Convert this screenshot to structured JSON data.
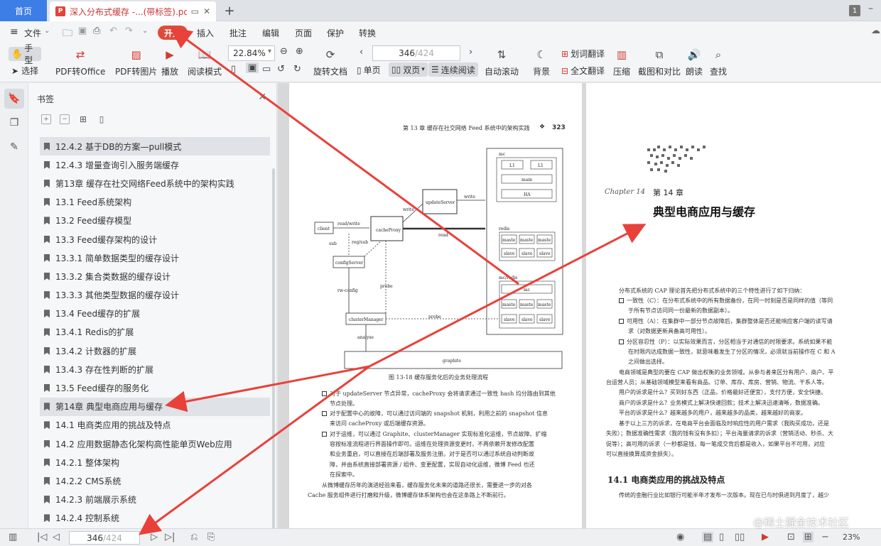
{
  "tabs": {
    "home_label": "首页",
    "doc_title": "深入分布式缓存 -...(带标签).pdf",
    "window_count": "1"
  },
  "menubar": {
    "file_label": "文件",
    "kaishi_label": "开始",
    "items": [
      "插入",
      "批注",
      "编辑",
      "页面",
      "保护",
      "转换"
    ]
  },
  "toolbar": {
    "hand_label": "手型",
    "select_label": "选择",
    "pdf_to_office": "PDF转Office",
    "pdf_to_image": "PDF转图片",
    "play": "播放",
    "read_mode": "阅读模式",
    "zoom_value": "22.84%",
    "rotate_doc": "旋转文档",
    "single_page": "单页",
    "double_page": "双页",
    "continuous_read": "连续阅读",
    "page_current": "346",
    "page_total": "/424",
    "auto_scroll": "自动滚动",
    "background": "背景",
    "word_translate": "划词翻译",
    "full_translate": "全文翻译",
    "compress": "压缩",
    "screenshot_compare": "截图和对比",
    "read_aloud": "朗读",
    "find": "查找"
  },
  "bookmarks": {
    "title": "书签",
    "items": [
      {
        "label": "12.4.2   基于DB的方案—pull模式",
        "highlighted": true
      },
      {
        "label": "12.4.3   增量查询引入服务端缓存",
        "highlighted": false
      },
      {
        "label": "第13章    缓存在社交网络Feed系统中的架构实践",
        "highlighted": false
      },
      {
        "label": "13.1   Feed系统架构",
        "highlighted": false
      },
      {
        "label": "13.2   Feed缓存模型",
        "highlighted": false
      },
      {
        "label": "13.3   Feed缓存架构的设计",
        "highlighted": false
      },
      {
        "label": "13.3.1   简单数据类型的缓存设计",
        "highlighted": false
      },
      {
        "label": "13.3.2   集合类数据的缓存设计",
        "highlighted": false
      },
      {
        "label": "13.3.3   其他类型数据的缓存设计",
        "highlighted": false
      },
      {
        "label": "13.4   Feed缓存的扩展",
        "highlighted": false
      },
      {
        "label": "13.4.1   Redis的扩展",
        "highlighted": false
      },
      {
        "label": "13.4.2   计数器的扩展",
        "highlighted": false
      },
      {
        "label": "13.4.3   存在性判断的扩展",
        "highlighted": false
      },
      {
        "label": "13.5   Feed缓存的服务化",
        "highlighted": false
      },
      {
        "label": "第14章    典型电商应用与缓存",
        "highlighted": true
      },
      {
        "label": "14.1   电商类应用的挑战及特点",
        "highlighted": false
      },
      {
        "label": "14.2   应用数据静态化架构高性能单页Web应用",
        "highlighted": false
      },
      {
        "label": "14.2.1   整体架构",
        "highlighted": false
      },
      {
        "label": "14.2.2   CMS系统",
        "highlighted": false
      },
      {
        "label": "14.2.3   前端展示系统",
        "highlighted": false
      },
      {
        "label": "14.2.4   控制系统",
        "highlighted": false
      }
    ]
  },
  "left_page": {
    "running_head": "第 13 章   缓存在社交网络 Feed 系统中的架构实践",
    "page_number": "323",
    "diagram": {
      "mc": "mc",
      "l1": "L1",
      "main": "main",
      "ha": "HA",
      "redis": "redis",
      "maste": "maste",
      "slave": "slave",
      "mcredis": "mc/redis",
      "mc_inner": "mc",
      "client": "client",
      "cacheproxy": "cacheProxy",
      "updateserver": "updateServer",
      "configserver": "configServer",
      "clustermanager": "clusterManager",
      "graphite": "graphite",
      "readwrite": "read/write",
      "write1": "write",
      "write2": "write",
      "read": "read",
      "sub": "sub",
      "regsub": "reg/sub",
      "rwconfig": "rw-config",
      "probe1": "probe",
      "probe2": "probe",
      "analyse": "analyse"
    },
    "figure_caption": "图 13-18   缓存服务化后的业务处理流程",
    "paragraphs": [
      "对于 updateServer 节点异常，cacheProxy 会将请求通过一致性 hash 均分路由到其他",
      "节点处理。",
      "对于配置中心的故障，可以通过访问端的 snapshot 机制，利用之前的 snapshot 信息",
      "来访问 cacheProxy 或后端缓存资源。",
      "对于运维，可以通过 Graphite、clusterManager 实现标准化运维，节点故障、扩缩",
      "容按标准流程进行界面操作即可。运维在处理资源变更时，不再依赖开发修改配置",
      "和业务重启，可以直接在后端部署及服务注册。对于是否可以通过系统自动判断故",
      "障，并由系统直接部署资源 / 组件、变更配置，实现自动化运维，微博 Feed 也还",
      "在探索中。",
      "从微博缓存历年的演进经验来看，缓存服务化未来的道路还很长，需要进一步的对各",
      "Cache 服务组件进行打磨和升级，微博缓存体系架构也会在这条路上不断前行。"
    ]
  },
  "right_page": {
    "chapter_script": "Chapter 14",
    "chapter_label": "第 14 章",
    "chapter_title": "典型电商应用与缓存",
    "paragraphs": [
      "分布式系统的 CAP 理论首先把分布式系统中的三个特性进行了如下归纳：",
      "一致性（C）：在分布式系统中的所有数据备份，在同一时刻是否是同样的值（等同",
      "于所有节点访问同一份最新的数据副本）。",
      "可用性（A）：在集群中一部分节点故障后，集群整体是否还能响应客户端的读写请",
      "求（对数据更新具备高可用性）。",
      "分区容忍性（P）：以实际效果而言，分区相当于对通信的时限要求。系统如果不能",
      "在时限内达成数据一致性，就意味着发生了分区的情况，必须就当前操作在 C 和 A",
      "之间做出选择。",
      "电商领域是典型的要在 CAP 做出权衡的业务领域。从参与者来区分有用户、商户、平",
      "台运营人员；从基础领域模型来看有商品、订单、库存、库房、营销、物流、干系人等。",
      "用户的诉求是什么？买到好东西（正品，价格最好还便宜），支付方便，安全快捷。",
      "商户的诉求是什么？业务模式上解决快速回款；技术上解决迅速清晰，数据准确。",
      "平台的诉求是什么？越来越多的用户，越来越多的品类，越来越好的商家。",
      "基于以上三方的诉求，在电商平台会面临及时响应性的用户需求（我购买成功，还是",
      "失败）；数据准确性需求（我的钱有没有多扣）；平台海量请求的诉求（营销活动、秒杀、大",
      "促等）；高可用的诉求（一秒都是钱，每一笔成交背后都是收入，如果平台不可用，对应",
      "可以直接换算成资金损失）。"
    ],
    "section_title": "14.1   电商类应用的挑战及特点",
    "section_text": "传统的金融行业比如银行可能半年才发布一次版本。现在已与时俱进到月度了，越少"
  },
  "statusbar": {
    "page_current": "346",
    "page_total": "/424",
    "zoom": "23%"
  },
  "watermark": "@稀土掘金技术社区",
  "colors": {
    "accent_red": "#e04a3a",
    "home_tab": "#3d7ee6",
    "arrow_red": "#e8413a"
  }
}
